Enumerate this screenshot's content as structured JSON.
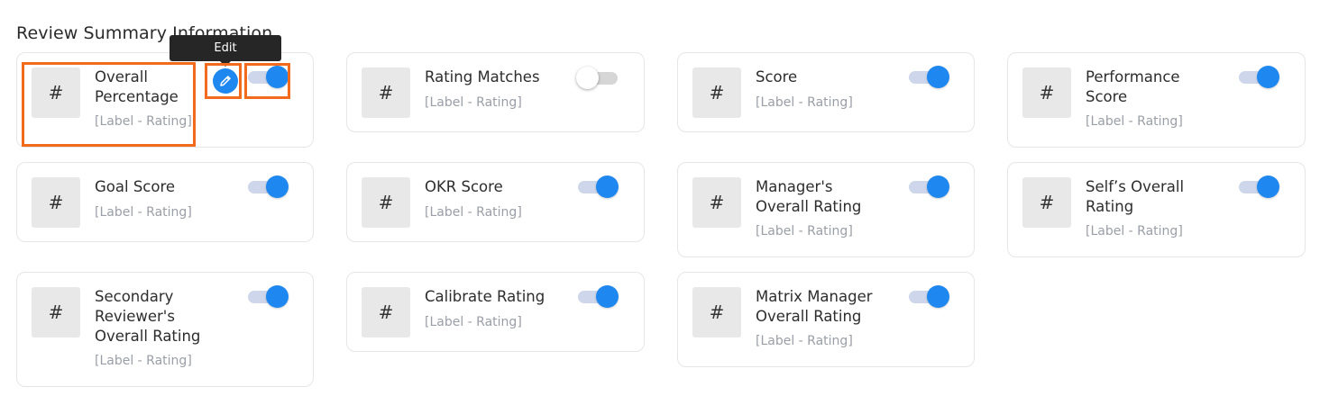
{
  "section": {
    "title": "Review Summary Information"
  },
  "tooltip": {
    "edit_label": "Edit"
  },
  "colors": {
    "accent": "#1e88f0",
    "highlight": "#f26a1b",
    "sub_text": "#9a9ea6"
  },
  "cards": [
    {
      "icon": "#",
      "title_lines": [
        "Overall",
        "Percentage"
      ],
      "subtitle": "[Label - Rating]",
      "enabled": true
    },
    {
      "icon": "#",
      "title_lines": [
        "Rating Matches"
      ],
      "subtitle": "[Label - Rating]",
      "enabled": false
    },
    {
      "icon": "#",
      "title_lines": [
        "Score"
      ],
      "subtitle": "[Label - Rating]",
      "enabled": true
    },
    {
      "icon": "#",
      "title_lines": [
        "Performance",
        "Score"
      ],
      "subtitle": "[Label - Rating]",
      "enabled": true
    },
    {
      "icon": "#",
      "title_lines": [
        "Goal Score"
      ],
      "subtitle": "[Label - Rating]",
      "enabled": true
    },
    {
      "icon": "#",
      "title_lines": [
        "OKR Score"
      ],
      "subtitle": "[Label - Rating]",
      "enabled": true
    },
    {
      "icon": "#",
      "title_lines": [
        "Manager's",
        "Overall Rating"
      ],
      "subtitle": "[Label - Rating]",
      "enabled": true
    },
    {
      "icon": "#",
      "title_lines": [
        "Self’s Overall",
        "Rating"
      ],
      "subtitle": "[Label - Rating]",
      "enabled": true
    },
    {
      "icon": "#",
      "title_lines": [
        "Secondary",
        "Reviewer's",
        "Overall Rating"
      ],
      "subtitle": "[Label - Rating]",
      "enabled": true
    },
    {
      "icon": "#",
      "title_lines": [
        "Calibrate Rating"
      ],
      "subtitle": "[Label - Rating]",
      "enabled": true
    },
    {
      "icon": "#",
      "title_lines": [
        "Matrix Manager",
        "Overall Rating"
      ],
      "subtitle": "[Label - Rating]",
      "enabled": true
    }
  ]
}
